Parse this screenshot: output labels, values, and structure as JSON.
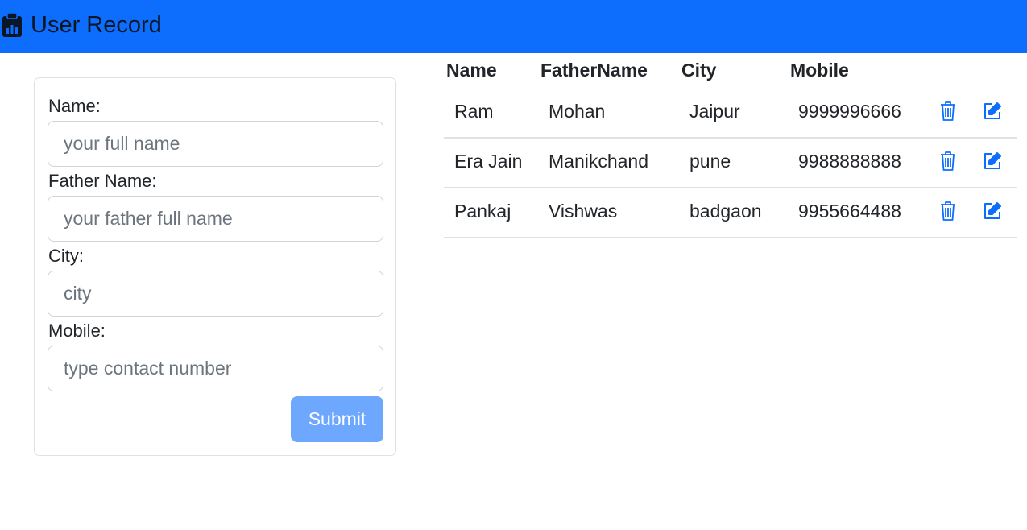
{
  "app": {
    "title": "User Record",
    "accent_color": "#0d6efd",
    "brand_icon": "clipboard-data-icon"
  },
  "form": {
    "fields": [
      {
        "label": "Name:",
        "placeholder": "your full name",
        "value": ""
      },
      {
        "label": "Father Name:",
        "placeholder": "your father full name",
        "value": ""
      },
      {
        "label": "City:",
        "placeholder": "city",
        "value": ""
      },
      {
        "label": "Mobile:",
        "placeholder": "type contact number",
        "value": ""
      }
    ],
    "submit_label": "Submit"
  },
  "table": {
    "columns": [
      "Name",
      "FatherName",
      "City",
      "Mobile"
    ],
    "rows": [
      {
        "name": "Ram",
        "father": "Mohan",
        "city": "Jaipur",
        "mobile": "9999996666"
      },
      {
        "name": "Era Jain",
        "father": "Manikchand",
        "city": "pune",
        "mobile": "9988888888"
      },
      {
        "name": "Pankaj",
        "father": "Vishwas",
        "city": "badgaon",
        "mobile": "9955664488"
      }
    ],
    "row_actions": [
      "trash-icon",
      "edit-icon"
    ]
  }
}
